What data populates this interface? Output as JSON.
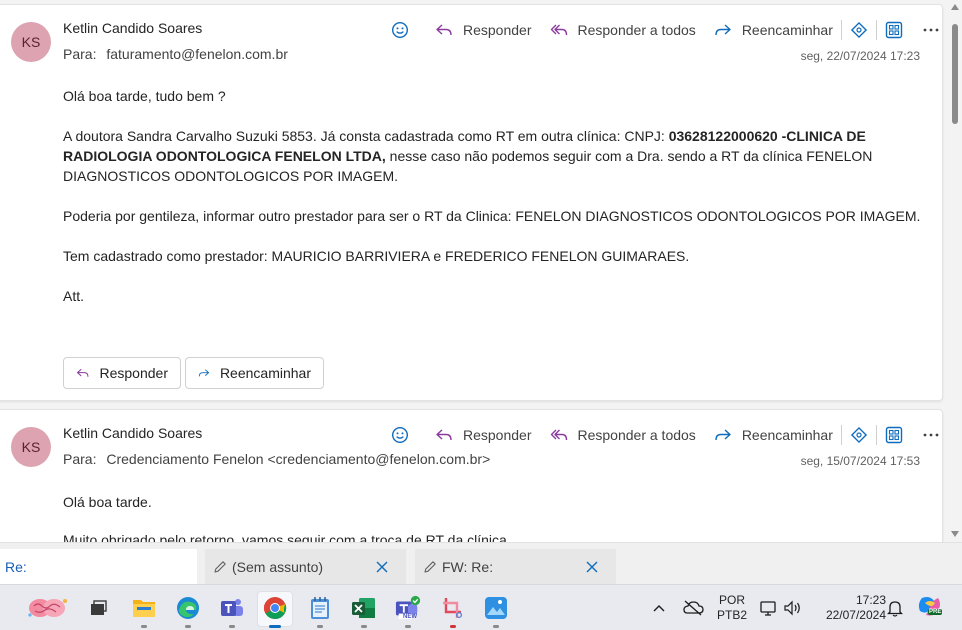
{
  "messages": [
    {
      "avatar_initials": "KS",
      "sender": "Ketlin Candido Soares",
      "to_label": "Para:",
      "to": "faturamento@fenelon.com.br",
      "date": "seg, 22/07/2024 17:23",
      "actions": {
        "reply": "Responder",
        "reply_all": "Responder a todos",
        "forward": "Reencaminhar"
      },
      "body": {
        "p1": "Olá boa tarde, tudo bem ?",
        "p2_a": "A doutora Sandra Carvalho Suzuki 5853. Já consta cadastrada como RT em outra clínica: CNPJ: ",
        "p2_bold": "03628122000620 -CLINICA DE RADIOLOGIA ODONTOLOGICA FENELON LTDA,",
        "p2_b": " nesse caso não podemos seguir com a Dra. sendo a RT da clínica FENELON DIAGNOSTICOS ODONTOLOGICOS POR IMAGEM.",
        "p3": "Poderia por gentileza, informar outro prestador para ser o RT da Clinica: FENELON DIAGNOSTICOS ODONTOLOGICOS POR IMAGEM.",
        "p4": "Tem cadastrado como prestador: MAURICIO BARRIVIERA e FREDERICO FENELON GUIMARAES.",
        "p5": "Att."
      },
      "buttons": {
        "reply": "Responder",
        "forward": "Reencaminhar"
      }
    },
    {
      "avatar_initials": "KS",
      "sender": "Ketlin Candido Soares",
      "to_label": "Para:",
      "to": "Credenciamento Fenelon <credenciamento@fenelon.com.br>",
      "date": "seg, 15/07/2024 17:53",
      "actions": {
        "reply": "Responder",
        "reply_all": "Responder a todos",
        "forward": "Reencaminhar"
      },
      "body": {
        "p1": "Olá boa tarde.",
        "p2": "Muito obrigado pelo retorno, vamos seguir com a troca de RT da clínica."
      }
    }
  ],
  "drafts": [
    {
      "label": "Re:"
    },
    {
      "label": "(Sem assunto)"
    },
    {
      "label": "FW: Re:"
    }
  ],
  "taskbar": {
    "apps": [
      "brain-widget-icon",
      "task-view-icon",
      "file-explorer-icon",
      "edge-icon",
      "teams-icon",
      "chrome-icon",
      "notepad-icon",
      "excel-icon",
      "teams-new-icon",
      "snipping-tool-icon",
      "photos-icon"
    ],
    "teams_new_badge": "NEW",
    "copilot_badge": "PRE",
    "language": [
      "POR",
      "PTB2"
    ],
    "time": "17:23",
    "date": "22/07/2024"
  },
  "colors": {
    "accent_blue": "#0f6cbd",
    "reply_all_purple": "#8a3b9b",
    "avatar_bg": "#dda3b1",
    "avatar_text": "#5a2230"
  }
}
